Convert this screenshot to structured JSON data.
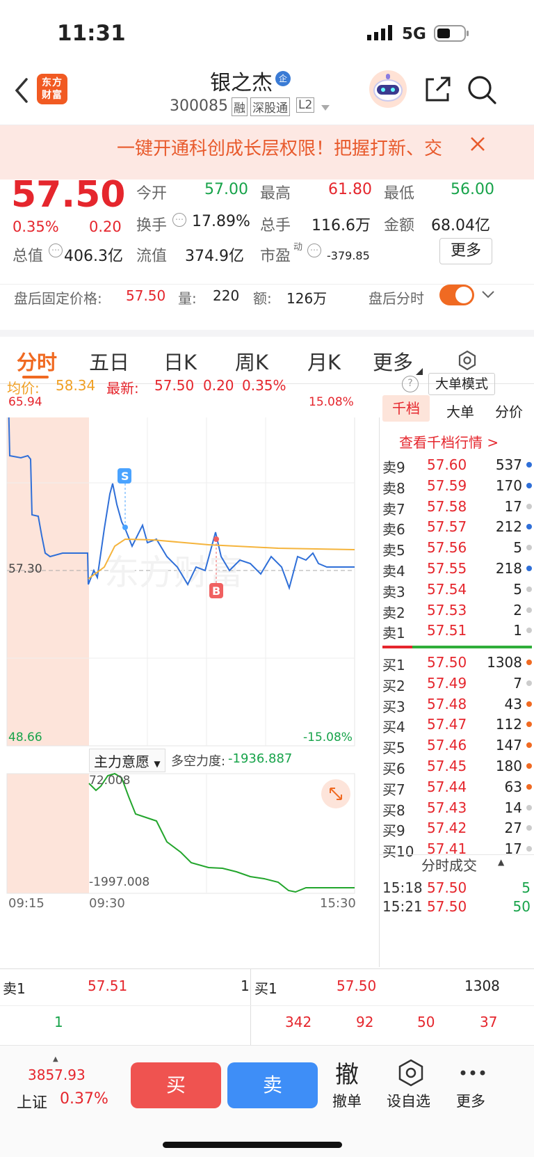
{
  "status": {
    "time": "11:31",
    "network": "5G"
  },
  "header": {
    "stock_name": "银之杰",
    "code": "300085",
    "badge_rong": "融",
    "badge_sgt": "深股通",
    "badge_l2": "L2",
    "badge_qi": "企",
    "logo_text": "东方财富"
  },
  "banner": {
    "text": "一键开通科创成长层权限！把握打新、交"
  },
  "quote": {
    "price": "57.50",
    "change_pct": "0.35%",
    "change": "0.20",
    "open_label": "今开",
    "open": "57.00",
    "high_label": "最高",
    "high": "61.80",
    "low_label": "最低",
    "low": "56.00",
    "turnover_label": "换手",
    "turnover": "17.89%",
    "volume_label": "总手",
    "volume": "116.6万",
    "amount_label": "金额",
    "amount": "68.04亿",
    "mktcap_label": "总值",
    "mktcap": "406.3亿",
    "float_label": "流值",
    "float_cap": "374.9亿",
    "pe_label": "市盈",
    "pe_sup": "动",
    "pe": "-379.85",
    "more_button": "更多"
  },
  "afterhours": {
    "label": "盘后固定价格:",
    "price": "57.50",
    "vol_label": "量:",
    "vol": "220",
    "amt_label": "额:",
    "amt": "126万",
    "toggle_label": "盘后分时",
    "toggle_on": true
  },
  "tabs": [
    {
      "label": "分时",
      "active": true
    },
    {
      "label": "五日"
    },
    {
      "label": "日K"
    },
    {
      "label": "周K"
    },
    {
      "label": "月K"
    },
    {
      "label": "更多"
    }
  ],
  "infobar": {
    "avg_label": "均价:",
    "avg": "58.34",
    "last_label": "最新:",
    "last": "57.50",
    "chg": "0.20",
    "chg_pct": "0.35%",
    "mode_button": "大单模式"
  },
  "chart": {
    "price_top": "65.94",
    "price_mid": "57.30",
    "price_bottom": "48.66",
    "pct_top": "15.08%",
    "pct_bottom": "-15.08%",
    "signal_s": "S",
    "signal_b": "B",
    "watermark": "东方财富",
    "indicator_label": "主力意愿",
    "indicator_value_label": "多空力度:",
    "indicator_value": "-1936.887",
    "ind_top": "72.008",
    "ind_bottom": "-1997.008",
    "times": [
      "09:15",
      "09:30",
      "15:30"
    ]
  },
  "chart_data": {
    "type": "line",
    "series": [
      {
        "name": "最新",
        "values": [
          57.3,
          57.8,
          59.8,
          58.6,
          59.0,
          58.2,
          58.0,
          57.7,
          57.4,
          57.6,
          57.5,
          58.5,
          57.8,
          57.6,
          57.5,
          57.3,
          57.6,
          57.5,
          57.6,
          57.5
        ]
      },
      {
        "name": "均价",
        "values": [
          57.3,
          58.1,
          58.45,
          58.4,
          58.38,
          58.36,
          58.35,
          58.35,
          58.34,
          58.34,
          58.34,
          58.34,
          58.34,
          58.34,
          58.34,
          58.34,
          58.34,
          58.34,
          58.34,
          58.34
        ]
      }
    ],
    "ylim": [
      48.66,
      65.94
    ]
  },
  "orderbook": {
    "tabs": [
      "千档",
      "大单",
      "分价"
    ],
    "link": "查看千档行情 >",
    "sells": [
      {
        "label": "卖9",
        "price": "57.60",
        "vol": "537",
        "dot": "#2f6fd8"
      },
      {
        "label": "卖8",
        "price": "57.59",
        "vol": "170",
        "dot": "#2f6fd8"
      },
      {
        "label": "卖7",
        "price": "57.58",
        "vol": "17",
        "dot": "#cccccc"
      },
      {
        "label": "卖6",
        "price": "57.57",
        "vol": "212",
        "dot": "#2f6fd8"
      },
      {
        "label": "卖5",
        "price": "57.56",
        "vol": "5",
        "dot": "#cccccc"
      },
      {
        "label": "卖4",
        "price": "57.55",
        "vol": "218",
        "dot": "#2f6fd8"
      },
      {
        "label": "卖3",
        "price": "57.54",
        "vol": "5",
        "dot": "#cccccc"
      },
      {
        "label": "卖2",
        "price": "57.53",
        "vol": "2",
        "dot": "#cccccc"
      },
      {
        "label": "卖1",
        "price": "57.51",
        "vol": "1",
        "dot": "#cccccc"
      }
    ],
    "buys": [
      {
        "label": "买1",
        "price": "57.50",
        "vol": "1308",
        "dot": "#f06a22"
      },
      {
        "label": "买2",
        "price": "57.49",
        "vol": "7",
        "dot": "#cccccc"
      },
      {
        "label": "买3",
        "price": "57.48",
        "vol": "43",
        "dot": "#f06a22"
      },
      {
        "label": "买4",
        "price": "57.47",
        "vol": "112",
        "dot": "#f06a22"
      },
      {
        "label": "买5",
        "price": "57.46",
        "vol": "147",
        "dot": "#f06a22"
      },
      {
        "label": "买6",
        "price": "57.45",
        "vol": "180",
        "dot": "#f06a22"
      },
      {
        "label": "买7",
        "price": "57.44",
        "vol": "63",
        "dot": "#f06a22"
      },
      {
        "label": "买8",
        "price": "57.43",
        "vol": "14",
        "dot": "#cccccc"
      },
      {
        "label": "买9",
        "price": "57.42",
        "vol": "27",
        "dot": "#cccccc"
      },
      {
        "label": "买10",
        "price": "57.41",
        "vol": "17",
        "dot": "#cccccc"
      }
    ],
    "trades_label": "分时成交",
    "trades": [
      {
        "time": "15:18",
        "price": "57.50",
        "vol": "5"
      },
      {
        "time": "15:21",
        "price": "57.50",
        "vol": "50"
      }
    ]
  },
  "bidask": {
    "sell_label": "卖1",
    "sell_price": "57.51",
    "sell_vol": "1",
    "buy_label": "买1",
    "buy_price": "57.50",
    "buy_vol": "1308",
    "sell_queue": "1",
    "buy_queue": [
      "342",
      "92",
      "50",
      "37"
    ]
  },
  "bottom": {
    "index_value": "3857.93",
    "index_name": "上证",
    "index_pct": "0.37%",
    "buy": "买",
    "sell": "卖",
    "cancel_icon": "撤",
    "cancel": "撤单",
    "watch": "设自选",
    "more": "更多"
  }
}
